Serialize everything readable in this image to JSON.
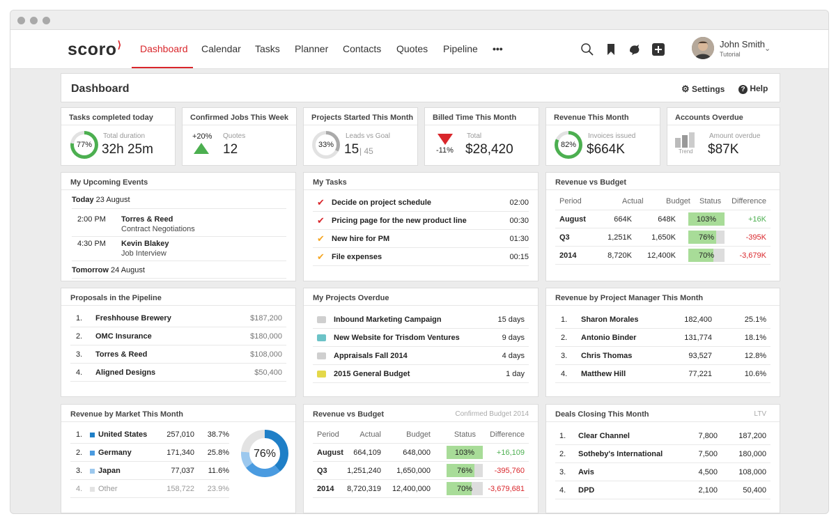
{
  "nav": {
    "logo": "scoro",
    "items": [
      "Dashboard",
      "Calendar",
      "Tasks",
      "Planner",
      "Contacts",
      "Quotes",
      "Pipeline",
      "•••"
    ],
    "user_name": "John Smith",
    "user_role": "Tutorial"
  },
  "dashboard": {
    "title": "Dashboard",
    "settings": "Settings",
    "help": "Help"
  },
  "kpis": {
    "tasks": {
      "title": "Tasks completed today",
      "ring": "77%",
      "ring_value": 0.77,
      "sub": "Total duration",
      "value": "32h 25m"
    },
    "jobs": {
      "title": "Confirmed Jobs This Week",
      "change": "+20%",
      "sub": "Quotes",
      "value": "12"
    },
    "projects": {
      "title": "Projects Started This Month",
      "ring": "33%",
      "ring_value": 0.33,
      "sub": "Leads vs Goal",
      "value": "15",
      "goal": "| 45"
    },
    "billed": {
      "title": "Billed Time This Month",
      "change": "-11%",
      "sub": "Total",
      "value": "$28,420"
    },
    "revenue": {
      "title": "Revenue This Month",
      "ring": "82%",
      "ring_value": 0.82,
      "sub": "Invoices issued",
      "value": "$664K"
    },
    "overdue": {
      "title": "Accounts Overdue",
      "trend": "Trend",
      "sub": "Amount overdue",
      "value": "$87K"
    }
  },
  "events": {
    "title": "My Upcoming Events",
    "today_label": "Today",
    "today_date": "23 August",
    "items": [
      {
        "time": "2:00 PM",
        "name": "Torres & Reed",
        "desc": "Contract Negotiations"
      },
      {
        "time": "4:30 PM",
        "name": "Kevin Blakey",
        "desc": "Job Interview"
      }
    ],
    "tomorrow_label": "Tomorrow",
    "tomorrow_date": "24 August"
  },
  "tasks": {
    "title": "My Tasks",
    "items": [
      {
        "name": "Decide on project schedule",
        "time": "02:00",
        "color": "#d9262b"
      },
      {
        "name": "Pricing page for the new product line",
        "time": "00:30",
        "color": "#d9262b"
      },
      {
        "name": "New hire for PM",
        "time": "01:30",
        "color": "#f5a623"
      },
      {
        "name": "File expenses",
        "time": "00:15",
        "color": "#f5a623"
      }
    ]
  },
  "rvb1": {
    "title": "Revenue vs Budget",
    "headers": [
      "Period",
      "Actual",
      "Budget",
      "Status",
      "Difference"
    ],
    "rows": [
      {
        "period": "August",
        "actual": "664K",
        "budget": "648K",
        "status": "103%",
        "status_value": 1.03,
        "diff": "+16K",
        "pos": true
      },
      {
        "period": "Q3",
        "actual": "1,251K",
        "budget": "1,650K",
        "status": "76%",
        "status_value": 0.76,
        "diff": "-395K",
        "pos": false
      },
      {
        "period": "2014",
        "actual": "8,720K",
        "budget": "12,400K",
        "status": "70%",
        "status_value": 0.7,
        "diff": "-3,679K",
        "pos": false
      }
    ]
  },
  "proposals": {
    "title": "Proposals in the Pipeline",
    "rows": [
      {
        "n": "1.",
        "name": "Freshhouse Brewery",
        "value": "$187,200"
      },
      {
        "n": "2.",
        "name": "OMC Insurance",
        "value": "$180,000"
      },
      {
        "n": "3.",
        "name": "Torres & Reed",
        "value": "$108,000"
      },
      {
        "n": "4.",
        "name": "Aligned Designs",
        "value": "$50,400"
      }
    ]
  },
  "projects_overdue": {
    "title": "My Projects Overdue",
    "rows": [
      {
        "name": "Inbound Marketing Campaign",
        "days": "15 days",
        "color": "#cfcfcf"
      },
      {
        "name": "New Website for Trisdom Ventures",
        "days": "9 days",
        "color": "#6cc3c7"
      },
      {
        "name": "Appraisals Fall 2014",
        "days": "4 days",
        "color": "#cfcfcf"
      },
      {
        "name": "2015 General Budget",
        "days": "1 day",
        "color": "#e4d84a"
      }
    ]
  },
  "by_manager": {
    "title": "Revenue by Project Manager This Month",
    "rows": [
      {
        "n": "1.",
        "name": "Sharon Morales",
        "value": "182,400",
        "pct": "25.1%"
      },
      {
        "n": "2.",
        "name": "Antonio Binder",
        "value": "131,774",
        "pct": "18.1%"
      },
      {
        "n": "3.",
        "name": "Chris Thomas",
        "value": "93,527",
        "pct": "12.8%"
      },
      {
        "n": "4.",
        "name": "Matthew Hill",
        "value": "77,221",
        "pct": "10.6%"
      }
    ]
  },
  "by_market": {
    "title": "Revenue by Market This Month",
    "donut": "76%",
    "rows": [
      {
        "n": "1.",
        "name": "United States",
        "value": "257,010",
        "pct": "38.7%",
        "share": 0.387,
        "color": "#1f7fc7",
        "muted": false
      },
      {
        "n": "2.",
        "name": "Germany",
        "value": "171,340",
        "pct": "25.8%",
        "share": 0.258,
        "color": "#4a9be0",
        "muted": false
      },
      {
        "n": "3.",
        "name": "Japan",
        "value": "77,037",
        "pct": "11.6%",
        "share": 0.116,
        "color": "#9cc8ee",
        "muted": false
      },
      {
        "n": "4.",
        "name": "Other",
        "value": "158,722",
        "pct": "23.9%",
        "share": 0.239,
        "color": "#e3e3e3",
        "muted": true
      }
    ]
  },
  "rvb2": {
    "title": "Revenue vs Budget",
    "note": "Confirmed Budget 2014",
    "headers": [
      "Period",
      "Actual",
      "Budget",
      "Status",
      "Difference"
    ],
    "rows": [
      {
        "period": "August",
        "actual": "664,109",
        "budget": "648,000",
        "status": "103%",
        "status_value": 1.03,
        "diff": "+16,109",
        "pos": true
      },
      {
        "period": "Q3",
        "actual": "1,251,240",
        "budget": "1,650,000",
        "status": "76%",
        "status_value": 0.76,
        "diff": "-395,760",
        "pos": false
      },
      {
        "period": "2014",
        "actual": "8,720,319",
        "budget": "12,400,000",
        "status": "70%",
        "status_value": 0.7,
        "diff": "-3,679,681",
        "pos": false
      }
    ]
  },
  "deals": {
    "title": "Deals Closing This Month",
    "note": "LTV",
    "rows": [
      {
        "n": "1.",
        "name": "Clear Channel",
        "value": "7,800",
        "ltv": "187,200"
      },
      {
        "n": "2.",
        "name": "Sotheby's International",
        "value": "7,500",
        "ltv": "180,000"
      },
      {
        "n": "3.",
        "name": "Avis",
        "value": "4,500",
        "ltv": "108,000"
      },
      {
        "n": "4.",
        "name": "DPD",
        "value": "2,100",
        "ltv": "50,400"
      }
    ]
  }
}
